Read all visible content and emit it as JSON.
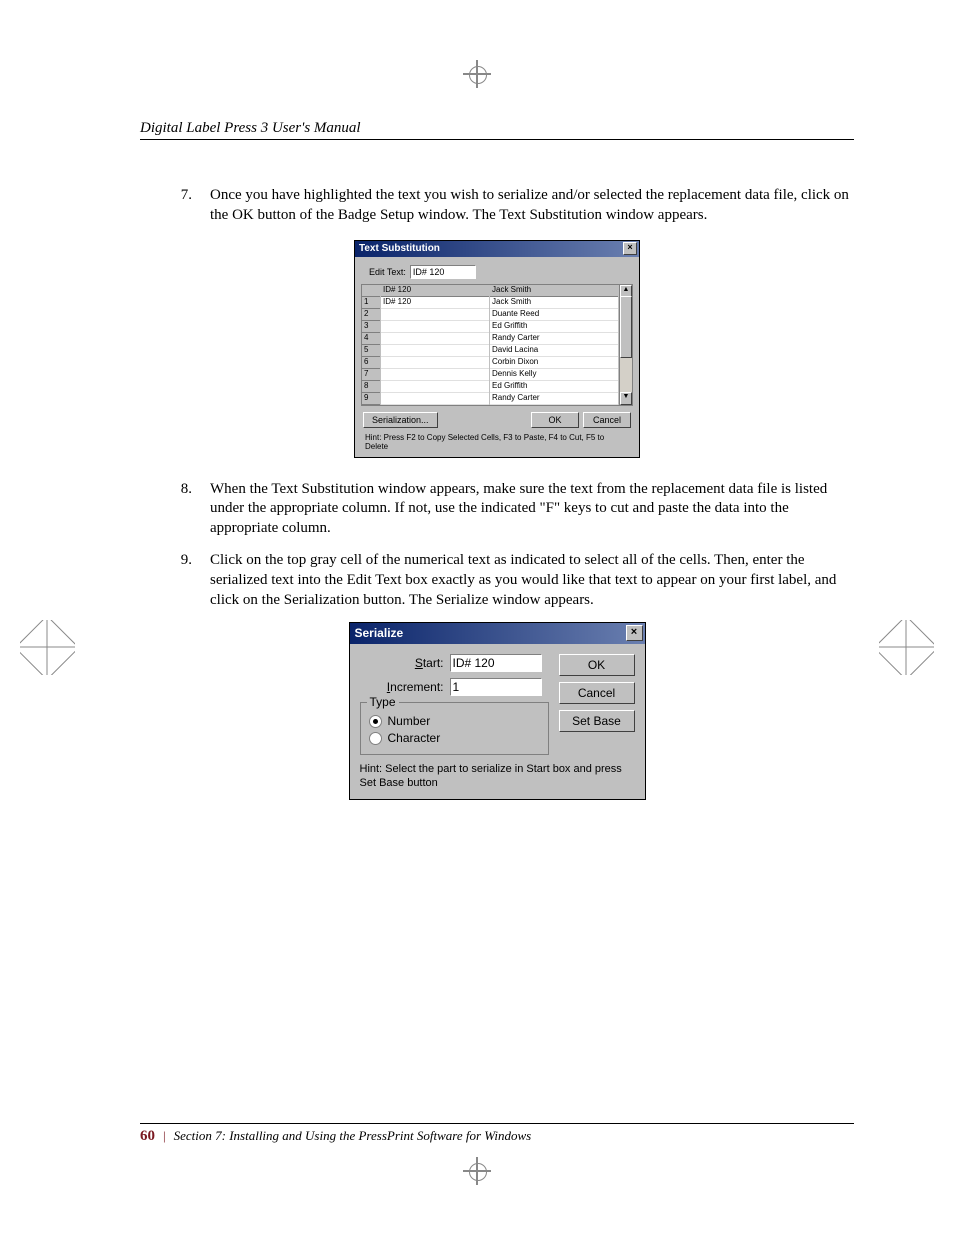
{
  "header": {
    "running": "Digital Label Press 3 User's Manual"
  },
  "steps": [
    {
      "num": "7.",
      "text": "Once you have highlighted the text you wish to serialize and/or selected the replacement data file, click on the OK button of the Badge Setup window.   The Text Substitution window appears."
    },
    {
      "num": "8.",
      "text": "When the Text Substitution window appears, make sure the text from the replacement data file is listed under the appropriate column.  If not, use the indicated \"F\" keys to cut and paste the data into the appropriate column."
    },
    {
      "num": "9.",
      "text": "Click on the top gray cell of the numerical text as indicated to select all of the cells.  Then, enter the serialized text into the Edit Text box exactly as you would like that text to appear on your first label, and click on the Serialization button.  The Serialize window appears."
    }
  ],
  "dlg1": {
    "title": "Text Substitution",
    "edit_label": "Edit Text:",
    "edit_value": "ID# 120",
    "col1_head": "ID# 120",
    "col2_head": "Jack Smith",
    "rows": [
      {
        "n": "1",
        "id": "ID# 120",
        "name": "Jack Smith"
      },
      {
        "n": "2",
        "id": "",
        "name": "Duante Reed"
      },
      {
        "n": "3",
        "id": "",
        "name": "Ed Griffith"
      },
      {
        "n": "4",
        "id": "",
        "name": "Randy Carter"
      },
      {
        "n": "5",
        "id": "",
        "name": "David Lacina"
      },
      {
        "n": "6",
        "id": "",
        "name": "Corbin Dixon"
      },
      {
        "n": "7",
        "id": "",
        "name": "Dennis Kelly"
      },
      {
        "n": "8",
        "id": "",
        "name": "Ed Griffith"
      },
      {
        "n": "9",
        "id": "",
        "name": "Randy Carter"
      }
    ],
    "serial_btn": "Serialization...",
    "ok": "OK",
    "cancel": "Cancel",
    "hint": "Hint: Press F2 to Copy Selected Cells, F3 to Paste, F4 to Cut, F5 to Delete"
  },
  "dlg2": {
    "title": "Serialize",
    "start_label_pre": "S",
    "start_label_rest": "tart:",
    "start_value": "ID# 120",
    "inc_label_pre": "I",
    "inc_label_rest": "ncrement:",
    "inc_value": "1",
    "group": "Type",
    "opt_num_pre": "N",
    "opt_num_rest": "umber",
    "opt_char_pre": "C",
    "opt_char_rest": "haracter",
    "ok": "OK",
    "cancel": "Cancel",
    "setbase_pre": "Set ",
    "setbase_u": "B",
    "setbase_post": "ase",
    "hint": "Hint: Select the part to serialize in Start box and press Set Base button"
  },
  "footer": {
    "page": "60",
    "section": "Section 7:  Installing and Using the PressPrint Software for Windows"
  }
}
